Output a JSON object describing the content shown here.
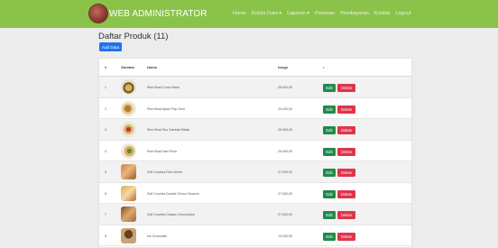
{
  "navbar": {
    "brand": "WEB ADMINISTRATOR",
    "menu": [
      "Home",
      "Kelola Data ▾",
      "Laporan ▾",
      "Pesanan",
      "Pembayaran",
      "Kontak",
      "Logout"
    ]
  },
  "page": {
    "title": "Daftar Produk (11)",
    "add_button": "Add Data"
  },
  "table": {
    "headers": [
      "#",
      "Gambar",
      "Nama",
      "harga",
      "•"
    ],
    "rows": [
      {
        "no": "1",
        "name": "Rice Bowl Cumi Hitam",
        "price": "25.000,00",
        "edit": "Edit",
        "delete": "Delete"
      },
      {
        "no": "2",
        "name": "Rice Bowl Ayam Pop Geni",
        "price": "23.000,00",
        "edit": "Edit",
        "delete": "Delete"
      },
      {
        "no": "3",
        "name": "Rice Bowl Eko Sambal Matah",
        "price": "25.000,00",
        "edit": "Edit",
        "delete": "Delete"
      },
      {
        "no": "4",
        "name": "Rice Bowl Nan Pedo",
        "price": "25.000,00",
        "edit": "Edit",
        "delete": "Delete"
      },
      {
        "no": "5",
        "name": "Soft Cookies Red Velvet",
        "price": "27.000,00",
        "edit": "Edit",
        "delete": "Delete"
      },
      {
        "no": "6",
        "name": "Soft Cookies Double Choco Smores",
        "price": "27.000,00",
        "edit": "Edit",
        "delete": "Delete"
      },
      {
        "no": "7",
        "name": "Soft Cookies Classic Chocochips",
        "price": "27.000,00",
        "edit": "Edit",
        "delete": "Delete"
      },
      {
        "no": "8",
        "name": "Ice Chocolate",
        "price": "13.000,00",
        "edit": "Edit",
        "delete": "Delete"
      }
    ]
  },
  "colors": {
    "navbar": "#8bc34a",
    "primary": "#1e73f3",
    "edit": "#1f8a4c",
    "delete": "#e0344a"
  }
}
